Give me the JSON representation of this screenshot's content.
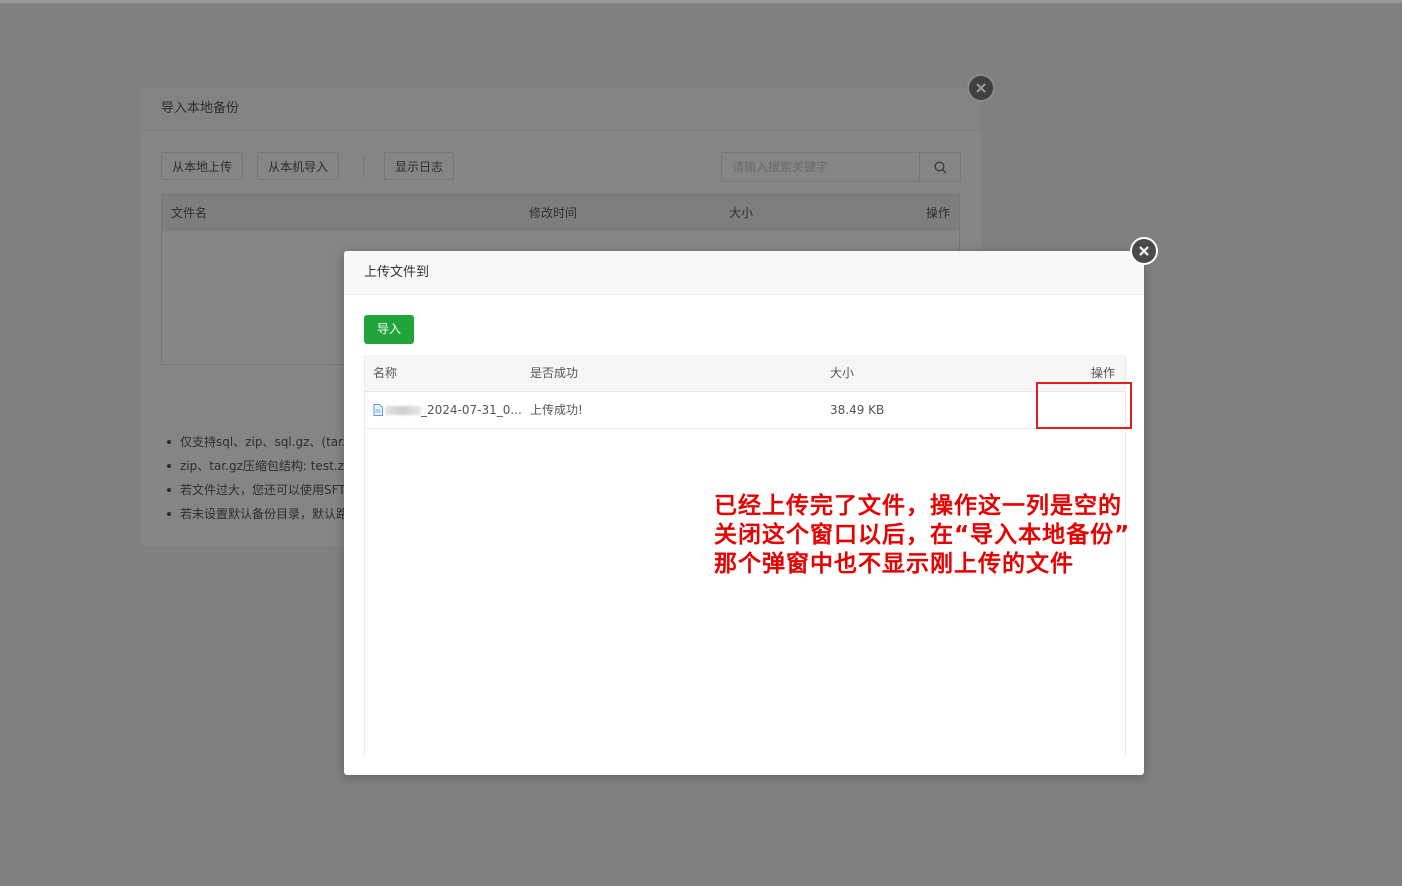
{
  "back_dialog": {
    "title": "导入本地备份",
    "buttons": {
      "upload_local": "从本地上传",
      "import_from_machine": "从本机导入",
      "show_log": "显示日志"
    },
    "search_placeholder": "请输入搜索关键字",
    "table_headers": [
      "文件名",
      "修改时间",
      "大小",
      "操作"
    ],
    "notes": [
      "仅支持sql、zip、sql.gz、(tar.g",
      "zip、tar.gz压缩包结构: test.zi",
      "若文件过大，您还可以使用SFT",
      "若未设置默认备份目录，默认路"
    ]
  },
  "front_dialog": {
    "title": "上传文件到",
    "import_button": "导入",
    "table_headers": [
      "名称",
      "是否成功",
      "大小",
      "操作"
    ],
    "rows": [
      {
        "name_suffix": "_2024-07-31_0...",
        "status": "上传成功!",
        "size": "38.49 KB",
        "action": ""
      }
    ]
  },
  "annotation": {
    "lines": [
      "已经上传完了文件，操作这一列是空的",
      "关闭这个窗口以后，在“导入本地备份”",
      "那个弹窗中也不显示刚上传的文件"
    ],
    "color": "#e60000"
  },
  "colors": {
    "overlay": "#808080",
    "primary_green": "#20a53a",
    "annotation_red": "#e02020"
  },
  "icons": {
    "close": "close-icon",
    "search": "search-icon",
    "file": "file-icon"
  }
}
